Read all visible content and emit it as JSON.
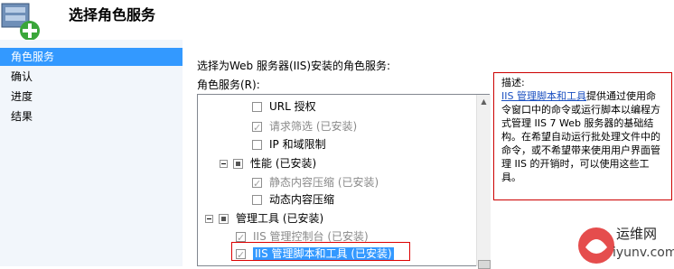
{
  "header": {
    "title": "选择角色服务",
    "icon": "role-services-wizard-icon"
  },
  "nav": {
    "items": [
      {
        "label": "角色服务",
        "active": true
      },
      {
        "label": "确认",
        "active": false
      },
      {
        "label": "进度",
        "active": false
      },
      {
        "label": "结果",
        "active": false
      }
    ]
  },
  "main": {
    "instruction": "选择为Web 服务器(IIS)安装的角色服务:",
    "role_services_label": "角色服务(R):",
    "tree": [
      {
        "label": "URL 授权",
        "checked": false,
        "disabled": false,
        "level": 3
      },
      {
        "label": "请求筛选 (已安装)",
        "checked": true,
        "disabled": true,
        "level": 3
      },
      {
        "label": "IP 和域限制",
        "checked": false,
        "disabled": false,
        "level": 3
      },
      {
        "label": "性能 (已安装)",
        "checked": "partial",
        "disabled": false,
        "level": 2,
        "expander": true
      },
      {
        "label": "静态内容压缩 (已安装)",
        "checked": true,
        "disabled": true,
        "level": 3
      },
      {
        "label": "动态内容压缩",
        "checked": false,
        "disabled": false,
        "level": 3
      },
      {
        "label": "管理工具 (已安装)",
        "checked": "partial",
        "disabled": false,
        "level": 1,
        "expander": true
      },
      {
        "label": "IIS 管理控制台 (已安装)",
        "checked": true,
        "disabled": true,
        "level": 2
      },
      {
        "label": "IIS 管理脚本和工具 (已安装)",
        "checked": true,
        "disabled": true,
        "level": 2,
        "selected": true
      }
    ]
  },
  "description": {
    "heading": "描述:",
    "link": "IIS 管理脚本和工具",
    "text": "提供通过使用命令窗口中的命令或运行脚本以编程方式管理 IIS 7 Web 服务器的基础结构。在希望自动运行批处理文件中的命令，或不希望带来使用用户界面管理 IIS 的开销时，可以使用这些工具。"
  },
  "watermark": {
    "name": "运维网",
    "domain": "iyunv.com"
  }
}
